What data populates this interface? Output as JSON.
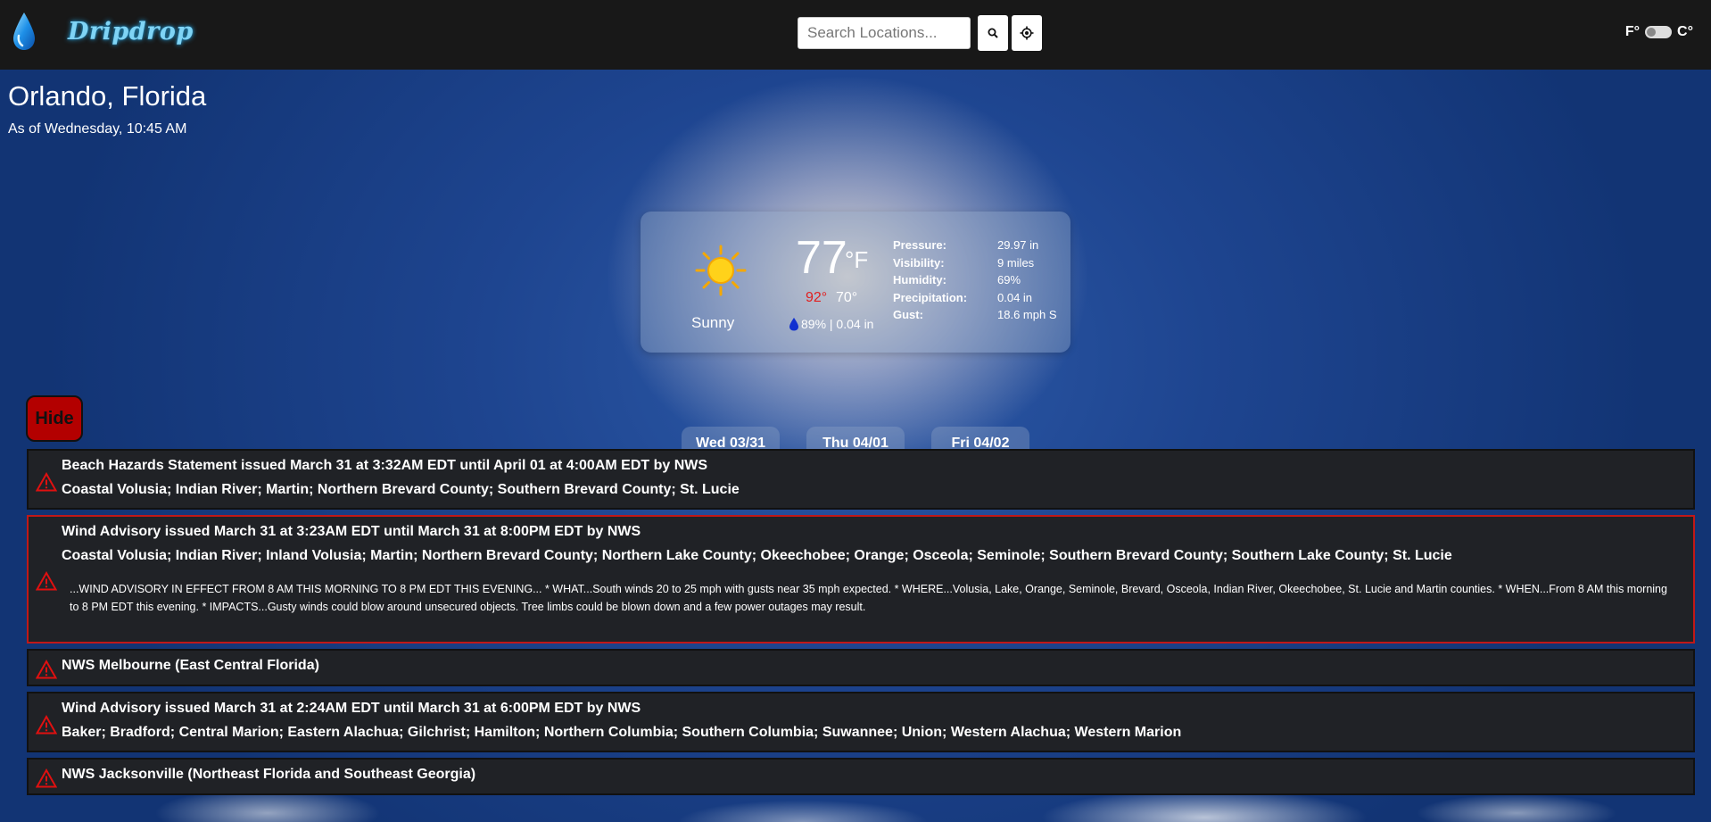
{
  "navbar": {
    "brand": "Dripdrop",
    "search_placeholder": "Search Locations...",
    "unit_f": "F°",
    "unit_c": "C°"
  },
  "location": {
    "name": "Orlando, Florida",
    "as_of": "As of Wednesday, 10:45 AM"
  },
  "current": {
    "condition": "Sunny",
    "temp": "77",
    "unit": "°F",
    "hi": "92°",
    "lo": "70°",
    "precip": "89% | 0.04 in",
    "stats": [
      {
        "label": "Pressure:",
        "value": "29.97 in"
      },
      {
        "label": "Visibility:",
        "value": "9 miles"
      },
      {
        "label": "Humidity:",
        "value": "69%"
      },
      {
        "label": "Precipitation:",
        "value": "0.04 in"
      },
      {
        "label": "Gust:",
        "value": "18.6 mph S"
      }
    ]
  },
  "forecast_tabs": [
    "Wed 03/31",
    "Thu 04/01",
    "Fri 04/02"
  ],
  "alerts_panel": {
    "hide_label": "Hide",
    "alerts": [
      {
        "title": "Beach Hazards Statement issued March 31 at 3:32AM EDT until April 01 at 4:00AM EDT by NWS",
        "areas": "Coastal Volusia; Indian River; Martin; Northern Brevard County; Southern Brevard County; St. Lucie"
      },
      {
        "title": "Wind Advisory issued March 31 at 3:23AM EDT until March 31 at 8:00PM EDT by NWS",
        "areas": "Coastal Volusia; Indian River; Inland Volusia; Martin; Northern Brevard County; Northern Lake County; Okeechobee; Orange; Osceola; Seminole; Southern Brevard County; Southern Lake County; St. Lucie",
        "description": "...WIND ADVISORY IN EFFECT FROM 8 AM THIS MORNING TO 8 PM EDT THIS EVENING... * WHAT...South winds 20 to 25 mph with gusts near 35 mph expected. * WHERE...Volusia, Lake, Orange, Seminole, Brevard, Osceola, Indian River, Okeechobee, St. Lucie and Martin counties. * WHEN...From 8 AM this morning to 8 PM EDT this evening. * IMPACTS...Gusty winds could blow around unsecured objects. Tree limbs could be blown down and a few power outages may result."
      },
      {
        "title": "NWS Melbourne (East Central Florida)"
      },
      {
        "title": "Wind Advisory issued March 31 at 2:24AM EDT until March 31 at 6:00PM EDT by NWS",
        "areas": "Baker; Bradford; Central Marion; Eastern Alachua; Gilchrist; Hamilton; Northern Columbia; Southern Columbia; Suwannee; Union; Western Alachua; Western Marion"
      },
      {
        "title": "NWS Jacksonville (Northeast Florida and Southeast Georgia)"
      }
    ]
  }
}
